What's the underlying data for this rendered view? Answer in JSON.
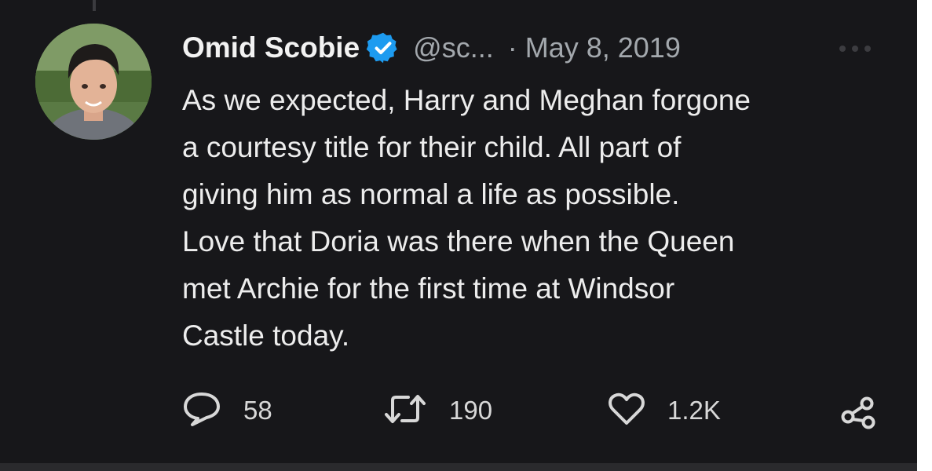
{
  "tweet": {
    "author": {
      "name": "Omid Scobie",
      "handle": "@sc...",
      "verified": true
    },
    "date_separator": "·",
    "date": "May 8, 2019",
    "text_lines": [
      "As we expected, Harry and Meghan forgone",
      "a courtesy title for their child. All part of",
      "giving him as normal a life as possible.",
      "Love that Doria was there when the Queen",
      "met Archie for the first time at Windsor",
      "Castle today."
    ],
    "stats": {
      "replies": "58",
      "retweets": "190",
      "likes": "1.2K"
    }
  },
  "icons": [
    "verified-badge-icon",
    "more-icon",
    "reply-icon",
    "retweet-icon",
    "like-icon",
    "share-icon"
  ],
  "colors": {
    "background": "#17171a",
    "text": "#e7e9ea",
    "secondary_text": "#a3a8ad",
    "verified": "#1d9bf0"
  }
}
